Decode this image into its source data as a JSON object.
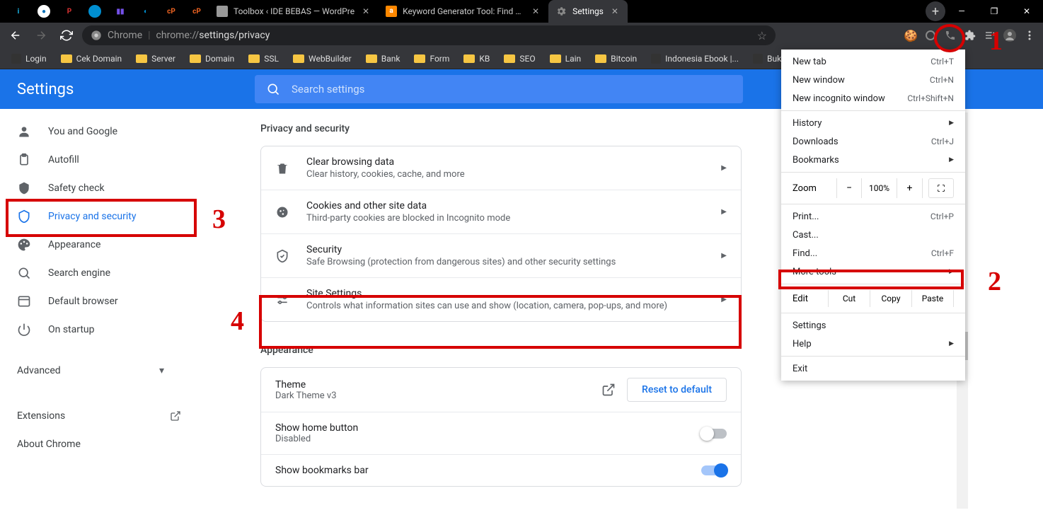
{
  "pinned": [
    {
      "color": "#000",
      "text": "i",
      "textcolor": "#1abaed"
    },
    {
      "color": "#fff",
      "text": "●",
      "textcolor": "#0070b8"
    },
    {
      "color": "#000",
      "text": "P",
      "textcolor": "#d33"
    },
    {
      "color": "#008fd1",
      "text": "",
      "textcolor": "#fff"
    },
    {
      "color": "#000",
      "text": "▮▮",
      "textcolor": "#7551e9"
    },
    {
      "color": "#000",
      "text": "◐",
      "textcolor": "#008fd1"
    },
    {
      "color": "#000",
      "text": "cP",
      "textcolor": "#f26522"
    },
    {
      "color": "#000",
      "text": "cP",
      "textcolor": "#f26522"
    }
  ],
  "tabs": [
    {
      "title": "Toolbox ‹ IDE BEBAS — WordPre",
      "icon": "wp",
      "active": false
    },
    {
      "title": "Keyword Generator Tool: Find Ke",
      "icon": "ahrefs",
      "active": false
    },
    {
      "title": "Settings",
      "icon": "gear",
      "active": true
    }
  ],
  "window": {
    "minimize": "—",
    "maximize": "❐",
    "close": "✕"
  },
  "addressbar": {
    "chrome_label": "Chrome",
    "url_protocol": "chrome://",
    "url_path": "settings/privacy"
  },
  "bookmarks": [
    {
      "label": "Login",
      "folder": false
    },
    {
      "label": "Cek Domain",
      "folder": true
    },
    {
      "label": "Server",
      "folder": true
    },
    {
      "label": "Domain",
      "folder": true
    },
    {
      "label": "SSL",
      "folder": true
    },
    {
      "label": "WebBuilder",
      "folder": true
    },
    {
      "label": "Bank",
      "folder": true
    },
    {
      "label": "Form",
      "folder": true
    },
    {
      "label": "KB",
      "folder": true
    },
    {
      "label": "SEO",
      "folder": true
    },
    {
      "label": "Lain",
      "folder": true
    },
    {
      "label": "Bitcoin",
      "folder": true
    },
    {
      "label": "Indonesia Ebook |...",
      "folder": false
    },
    {
      "label": "Buku",
      "folder": false
    }
  ],
  "settings": {
    "title": "Settings",
    "search_placeholder": "Search settings",
    "nav": [
      {
        "icon": "person",
        "label": "You and Google"
      },
      {
        "icon": "clipboard",
        "label": "Autofill"
      },
      {
        "icon": "shield",
        "label": "Safety check"
      },
      {
        "icon": "shield2",
        "label": "Privacy and security",
        "selected": true
      },
      {
        "icon": "palette",
        "label": "Appearance"
      },
      {
        "icon": "search",
        "label": "Search engine"
      },
      {
        "icon": "browser",
        "label": "Default browser"
      },
      {
        "icon": "power",
        "label": "On startup"
      }
    ],
    "advanced": "Advanced",
    "extensions": "Extensions",
    "about": "About Chrome"
  },
  "content": {
    "privacy_heading": "Privacy and security",
    "rows": [
      {
        "icon": "trash",
        "title": "Clear browsing data",
        "sub": "Clear history, cookies, cache, and more"
      },
      {
        "icon": "cookie",
        "title": "Cookies and other site data",
        "sub": "Third-party cookies are blocked in Incognito mode"
      },
      {
        "icon": "shield",
        "title": "Security",
        "sub": "Safe Browsing (protection from dangerous sites) and other security settings"
      },
      {
        "icon": "sliders",
        "title": "Site Settings",
        "sub": "Controls what information sites can use and show (location, camera, pop-ups, and more)"
      }
    ],
    "appearance_heading": "Appearance",
    "theme": {
      "title": "Theme",
      "sub": "Dark Theme v3",
      "reset": "Reset to default"
    },
    "home_button": {
      "title": "Show home button",
      "sub": "Disabled"
    },
    "bookmarks_bar": {
      "title": "Show bookmarks bar"
    }
  },
  "menu": {
    "new_tab": {
      "label": "New tab",
      "shortcut": "Ctrl+T"
    },
    "new_window": {
      "label": "New window",
      "shortcut": "Ctrl+N"
    },
    "new_incognito": {
      "label": "New incognito window",
      "shortcut": "Ctrl+Shift+N"
    },
    "history": {
      "label": "History"
    },
    "downloads": {
      "label": "Downloads",
      "shortcut": "Ctrl+J"
    },
    "bookmarks": {
      "label": "Bookmarks"
    },
    "zoom": {
      "label": "Zoom",
      "value": "100%"
    },
    "print": {
      "label": "Print...",
      "shortcut": "Ctrl+P"
    },
    "cast": {
      "label": "Cast..."
    },
    "find": {
      "label": "Find...",
      "shortcut": "Ctrl+F"
    },
    "more_tools": {
      "label": "More tools"
    },
    "edit": {
      "label": "Edit",
      "cut": "Cut",
      "copy": "Copy",
      "paste": "Paste"
    },
    "settings": {
      "label": "Settings"
    },
    "help": {
      "label": "Help"
    },
    "exit": {
      "label": "Exit"
    }
  },
  "annotations": {
    "n1": "1",
    "n2": "2",
    "n3": "3",
    "n4": "4"
  }
}
